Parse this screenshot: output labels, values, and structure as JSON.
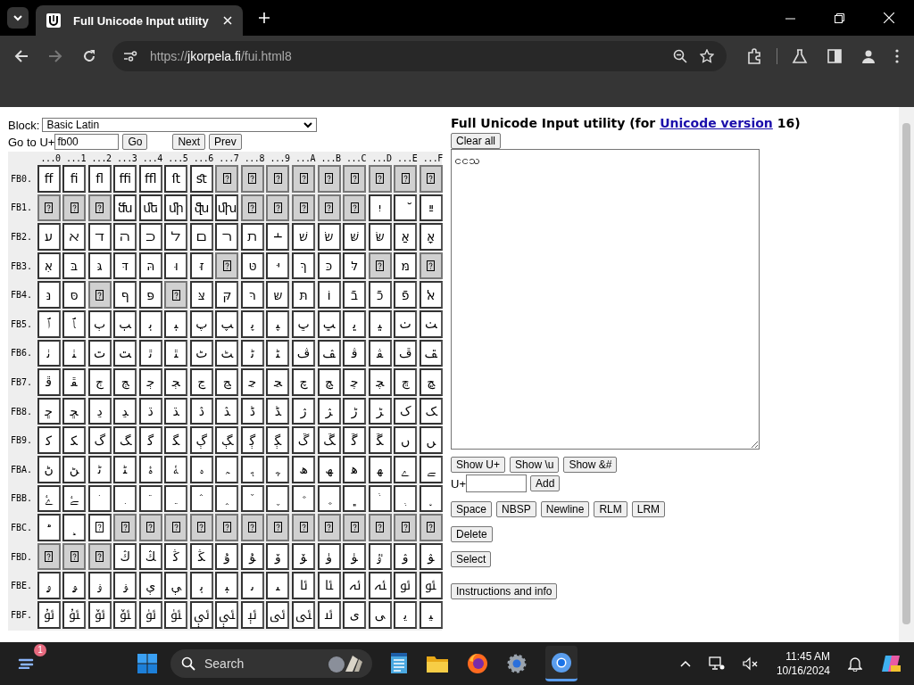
{
  "browser": {
    "tab_title": "Full Unicode Input utility",
    "url_scheme": "https://",
    "url_host": "jkorpela.fi",
    "url_path": "/fui.html8"
  },
  "controls": {
    "block_label": "Block:",
    "block_value": "Basic Latin",
    "goto_label": "Go to U+",
    "goto_value": "fb00",
    "go": "Go",
    "next": "Next",
    "prev": "Prev"
  },
  "grid": {
    "columns": [
      "...0",
      "...1",
      "...2",
      "...3",
      "...4",
      "...5",
      "...6",
      "...7",
      "...8",
      "...9",
      "...A",
      "...B",
      "...C",
      "...D",
      "...E",
      "...F"
    ],
    "rows": [
      {
        "label": "FB0.",
        "cells": [
          {
            "kind": "char",
            "text": "ﬀ"
          },
          {
            "kind": "char",
            "text": "ﬁ"
          },
          {
            "kind": "char",
            "text": "ﬂ"
          },
          {
            "kind": "char",
            "text": "ﬃ"
          },
          {
            "kind": "char",
            "text": "ﬄ"
          },
          {
            "kind": "char",
            "text": "ﬅ"
          },
          {
            "kind": "char",
            "text": "ﬆ"
          },
          {
            "kind": "unassigned"
          },
          {
            "kind": "unassigned"
          },
          {
            "kind": "unassigned"
          },
          {
            "kind": "unassigned"
          },
          {
            "kind": "unassigned"
          },
          {
            "kind": "unassigned"
          },
          {
            "kind": "unassigned"
          },
          {
            "kind": "unassigned"
          },
          {
            "kind": "unassigned"
          }
        ]
      },
      {
        "label": "FB1.",
        "cells": [
          {
            "kind": "unassigned"
          },
          {
            "kind": "unassigned"
          },
          {
            "kind": "unassigned"
          },
          {
            "kind": "char",
            "text": "ﬓ"
          },
          {
            "kind": "char",
            "text": "ﬔ"
          },
          {
            "kind": "char",
            "text": "ﬕ"
          },
          {
            "kind": "char",
            "text": "ﬖ"
          },
          {
            "kind": "char",
            "text": "ﬗ"
          },
          {
            "kind": "unassigned"
          },
          {
            "kind": "unassigned"
          },
          {
            "kind": "unassigned"
          },
          {
            "kind": "unassigned"
          },
          {
            "kind": "unassigned"
          },
          {
            "kind": "char",
            "text": "יִ"
          },
          {
            "kind": "char",
            "text": "ﬞ"
          },
          {
            "kind": "char",
            "text": "ײַ"
          }
        ]
      },
      {
        "label": "FB2.",
        "cells": [
          {
            "kind": "char",
            "text": "ﬠ"
          },
          {
            "kind": "char",
            "text": "ﬡ"
          },
          {
            "kind": "char",
            "text": "ﬢ"
          },
          {
            "kind": "char",
            "text": "ﬣ"
          },
          {
            "kind": "char",
            "text": "ﬤ"
          },
          {
            "kind": "char",
            "text": "ﬥ"
          },
          {
            "kind": "char",
            "text": "ﬦ"
          },
          {
            "kind": "char",
            "text": "ﬧ"
          },
          {
            "kind": "char",
            "text": "ﬨ"
          },
          {
            "kind": "char",
            "text": "﬩"
          },
          {
            "kind": "char",
            "text": "שׁ"
          },
          {
            "kind": "char",
            "text": "שׂ"
          },
          {
            "kind": "char",
            "text": "שּׁ"
          },
          {
            "kind": "char",
            "text": "שּׂ"
          },
          {
            "kind": "char",
            "text": "אַ"
          },
          {
            "kind": "char",
            "text": "אָ"
          }
        ]
      },
      {
        "label": "FB3.",
        "cells": [
          {
            "kind": "char",
            "text": "אּ"
          },
          {
            "kind": "char",
            "text": "בּ"
          },
          {
            "kind": "char",
            "text": "גּ"
          },
          {
            "kind": "char",
            "text": "דּ"
          },
          {
            "kind": "char",
            "text": "הּ"
          },
          {
            "kind": "char",
            "text": "וּ"
          },
          {
            "kind": "char",
            "text": "זּ"
          },
          {
            "kind": "unassigned"
          },
          {
            "kind": "char",
            "text": "טּ"
          },
          {
            "kind": "char",
            "text": "יּ"
          },
          {
            "kind": "char",
            "text": "ךּ"
          },
          {
            "kind": "char",
            "text": "כּ"
          },
          {
            "kind": "char",
            "text": "לּ"
          },
          {
            "kind": "unassigned"
          },
          {
            "kind": "char",
            "text": "מּ"
          },
          {
            "kind": "unassigned"
          }
        ]
      },
      {
        "label": "FB4.",
        "cells": [
          {
            "kind": "char",
            "text": "נּ"
          },
          {
            "kind": "char",
            "text": "סּ"
          },
          {
            "kind": "unassigned"
          },
          {
            "kind": "char",
            "text": "ףּ"
          },
          {
            "kind": "char",
            "text": "פּ"
          },
          {
            "kind": "unassigned"
          },
          {
            "kind": "char",
            "text": "צּ"
          },
          {
            "kind": "char",
            "text": "קּ"
          },
          {
            "kind": "char",
            "text": "רּ"
          },
          {
            "kind": "char",
            "text": "שּ"
          },
          {
            "kind": "char",
            "text": "תּ"
          },
          {
            "kind": "char",
            "text": "וֹ"
          },
          {
            "kind": "char",
            "text": "בֿ"
          },
          {
            "kind": "char",
            "text": "כֿ"
          },
          {
            "kind": "char",
            "text": "פֿ"
          },
          {
            "kind": "char",
            "text": "ﭏ"
          }
        ]
      },
      {
        "label": "FB5.",
        "cells": [
          {
            "kind": "char",
            "text": "ﭐ"
          },
          {
            "kind": "char",
            "text": "ﭑ"
          },
          {
            "kind": "char",
            "text": "ﭒ"
          },
          {
            "kind": "char",
            "text": "ﭓ"
          },
          {
            "kind": "char",
            "text": "ﭔ"
          },
          {
            "kind": "char",
            "text": "ﭕ"
          },
          {
            "kind": "char",
            "text": "ﭖ"
          },
          {
            "kind": "char",
            "text": "ﭗ"
          },
          {
            "kind": "char",
            "text": "ﭘ"
          },
          {
            "kind": "char",
            "text": "ﭙ"
          },
          {
            "kind": "char",
            "text": "ﭚ"
          },
          {
            "kind": "char",
            "text": "ﭛ"
          },
          {
            "kind": "char",
            "text": "ﭜ"
          },
          {
            "kind": "char",
            "text": "ﭝ"
          },
          {
            "kind": "char",
            "text": "ﭞ"
          },
          {
            "kind": "char",
            "text": "ﭟ"
          }
        ]
      },
      {
        "label": "FB6.",
        "cells": [
          {
            "kind": "char",
            "text": "ﭠ"
          },
          {
            "kind": "char",
            "text": "ﭡ"
          },
          {
            "kind": "char",
            "text": "ﭢ"
          },
          {
            "kind": "char",
            "text": "ﭣ"
          },
          {
            "kind": "char",
            "text": "ﭤ"
          },
          {
            "kind": "char",
            "text": "ﭥ"
          },
          {
            "kind": "char",
            "text": "ﭦ"
          },
          {
            "kind": "char",
            "text": "ﭧ"
          },
          {
            "kind": "char",
            "text": "ﭨ"
          },
          {
            "kind": "char",
            "text": "ﭩ"
          },
          {
            "kind": "char",
            "text": "ﭪ"
          },
          {
            "kind": "char",
            "text": "ﭫ"
          },
          {
            "kind": "char",
            "text": "ﭬ"
          },
          {
            "kind": "char",
            "text": "ﭭ"
          },
          {
            "kind": "char",
            "text": "ﭮ"
          },
          {
            "kind": "char",
            "text": "ﭯ"
          }
        ]
      },
      {
        "label": "FB7.",
        "cells": [
          {
            "kind": "char",
            "text": "ﭰ"
          },
          {
            "kind": "char",
            "text": "ﭱ"
          },
          {
            "kind": "char",
            "text": "ﭲ"
          },
          {
            "kind": "char",
            "text": "ﭳ"
          },
          {
            "kind": "char",
            "text": "ﭴ"
          },
          {
            "kind": "char",
            "text": "ﭵ"
          },
          {
            "kind": "char",
            "text": "ﭶ"
          },
          {
            "kind": "char",
            "text": "ﭷ"
          },
          {
            "kind": "char",
            "text": "ﭸ"
          },
          {
            "kind": "char",
            "text": "ﭹ"
          },
          {
            "kind": "char",
            "text": "ﭺ"
          },
          {
            "kind": "char",
            "text": "ﭻ"
          },
          {
            "kind": "char",
            "text": "ﭼ"
          },
          {
            "kind": "char",
            "text": "ﭽ"
          },
          {
            "kind": "char",
            "text": "ﭾ"
          },
          {
            "kind": "char",
            "text": "ﭿ"
          }
        ]
      },
      {
        "label": "FB8.",
        "cells": [
          {
            "kind": "char",
            "text": "ﮀ"
          },
          {
            "kind": "char",
            "text": "ﮁ"
          },
          {
            "kind": "char",
            "text": "ﮂ"
          },
          {
            "kind": "char",
            "text": "ﮃ"
          },
          {
            "kind": "char",
            "text": "ﮄ"
          },
          {
            "kind": "char",
            "text": "ﮅ"
          },
          {
            "kind": "char",
            "text": "ﮆ"
          },
          {
            "kind": "char",
            "text": "ﮇ"
          },
          {
            "kind": "char",
            "text": "ﮈ"
          },
          {
            "kind": "char",
            "text": "ﮉ"
          },
          {
            "kind": "char",
            "text": "ﮊ"
          },
          {
            "kind": "char",
            "text": "ﮋ"
          },
          {
            "kind": "char",
            "text": "ﮌ"
          },
          {
            "kind": "char",
            "text": "ﮍ"
          },
          {
            "kind": "char",
            "text": "ﮎ"
          },
          {
            "kind": "char",
            "text": "ﮏ"
          }
        ]
      },
      {
        "label": "FB9.",
        "cells": [
          {
            "kind": "char",
            "text": "ﮐ"
          },
          {
            "kind": "char",
            "text": "ﮑ"
          },
          {
            "kind": "char",
            "text": "ﮒ"
          },
          {
            "kind": "char",
            "text": "ﮓ"
          },
          {
            "kind": "char",
            "text": "ﮔ"
          },
          {
            "kind": "char",
            "text": "ﮕ"
          },
          {
            "kind": "char",
            "text": "ﮖ"
          },
          {
            "kind": "char",
            "text": "ﮗ"
          },
          {
            "kind": "char",
            "text": "ﮘ"
          },
          {
            "kind": "char",
            "text": "ﮙ"
          },
          {
            "kind": "char",
            "text": "ﮚ"
          },
          {
            "kind": "char",
            "text": "ﮛ"
          },
          {
            "kind": "char",
            "text": "ﮜ"
          },
          {
            "kind": "char",
            "text": "ﮝ"
          },
          {
            "kind": "char",
            "text": "ﮞ"
          },
          {
            "kind": "char",
            "text": "ﮟ"
          }
        ]
      },
      {
        "label": "FBA.",
        "cells": [
          {
            "kind": "char",
            "text": "ﮠ"
          },
          {
            "kind": "char",
            "text": "ﮡ"
          },
          {
            "kind": "char",
            "text": "ﮢ"
          },
          {
            "kind": "char",
            "text": "ﮣ"
          },
          {
            "kind": "char",
            "text": "ﮤ"
          },
          {
            "kind": "char",
            "text": "ﮥ"
          },
          {
            "kind": "char",
            "text": "ﮦ"
          },
          {
            "kind": "char",
            "text": "ﮧ"
          },
          {
            "kind": "char",
            "text": "ﮨ"
          },
          {
            "kind": "char",
            "text": "ﮩ"
          },
          {
            "kind": "char",
            "text": "ﮪ"
          },
          {
            "kind": "char",
            "text": "ﮫ"
          },
          {
            "kind": "char",
            "text": "ﮬ"
          },
          {
            "kind": "char",
            "text": "ﮭ"
          },
          {
            "kind": "char",
            "text": "ﮮ"
          },
          {
            "kind": "char",
            "text": "ﮯ"
          }
        ]
      },
      {
        "label": "FBB.",
        "cells": [
          {
            "kind": "char",
            "text": "ﮰ"
          },
          {
            "kind": "char",
            "text": "ﮱ"
          },
          {
            "kind": "char",
            "text": "﮲"
          },
          {
            "kind": "char",
            "text": "﮳"
          },
          {
            "kind": "char",
            "text": "﮴"
          },
          {
            "kind": "char",
            "text": "﮵"
          },
          {
            "kind": "char",
            "text": "﮶"
          },
          {
            "kind": "char",
            "text": "﮷"
          },
          {
            "kind": "char",
            "text": "﮸"
          },
          {
            "kind": "char",
            "text": "﮹"
          },
          {
            "kind": "char",
            "text": "﮺"
          },
          {
            "kind": "char",
            "text": "﮻"
          },
          {
            "kind": "char",
            "text": "﮼"
          },
          {
            "kind": "char",
            "text": "﮽"
          },
          {
            "kind": "char",
            "text": "﮾"
          },
          {
            "kind": "char",
            "text": "﮿"
          }
        ]
      },
      {
        "label": "FBC.",
        "cells": [
          {
            "kind": "char",
            "text": "﯀"
          },
          {
            "kind": "char",
            "text": "﯁"
          },
          {
            "kind": "nofont"
          },
          {
            "kind": "unassigned"
          },
          {
            "kind": "unassigned"
          },
          {
            "kind": "unassigned"
          },
          {
            "kind": "unassigned"
          },
          {
            "kind": "unassigned"
          },
          {
            "kind": "unassigned"
          },
          {
            "kind": "unassigned"
          },
          {
            "kind": "unassigned"
          },
          {
            "kind": "unassigned"
          },
          {
            "kind": "unassigned"
          },
          {
            "kind": "unassigned"
          },
          {
            "kind": "unassigned"
          },
          {
            "kind": "unassigned"
          }
        ]
      },
      {
        "label": "FBD.",
        "cells": [
          {
            "kind": "unassigned"
          },
          {
            "kind": "unassigned"
          },
          {
            "kind": "unassigned"
          },
          {
            "kind": "char",
            "text": "ﯓ"
          },
          {
            "kind": "char",
            "text": "ﯔ"
          },
          {
            "kind": "char",
            "text": "ﯕ"
          },
          {
            "kind": "char",
            "text": "ﯖ"
          },
          {
            "kind": "char",
            "text": "ﯗ"
          },
          {
            "kind": "char",
            "text": "ﯘ"
          },
          {
            "kind": "char",
            "text": "ﯙ"
          },
          {
            "kind": "char",
            "text": "ﯚ"
          },
          {
            "kind": "char",
            "text": "ﯛ"
          },
          {
            "kind": "char",
            "text": "ﯜ"
          },
          {
            "kind": "char",
            "text": "ﯝ"
          },
          {
            "kind": "char",
            "text": "ﯞ"
          },
          {
            "kind": "char",
            "text": "ﯟ"
          }
        ]
      },
      {
        "label": "FBE.",
        "cells": [
          {
            "kind": "char",
            "text": "ﯠ"
          },
          {
            "kind": "char",
            "text": "ﯡ"
          },
          {
            "kind": "char",
            "text": "ﯢ"
          },
          {
            "kind": "char",
            "text": "ﯣ"
          },
          {
            "kind": "char",
            "text": "ﯤ"
          },
          {
            "kind": "char",
            "text": "ﯥ"
          },
          {
            "kind": "char",
            "text": "ﯦ"
          },
          {
            "kind": "char",
            "text": "ﯧ"
          },
          {
            "kind": "char",
            "text": "ﯨ"
          },
          {
            "kind": "char",
            "text": "ﯩ"
          },
          {
            "kind": "char",
            "text": "ﯪ"
          },
          {
            "kind": "char",
            "text": "ﯫ"
          },
          {
            "kind": "char",
            "text": "ﯬ"
          },
          {
            "kind": "char",
            "text": "ﯭ"
          },
          {
            "kind": "char",
            "text": "ﯮ"
          },
          {
            "kind": "char",
            "text": "ﯯ"
          }
        ]
      },
      {
        "label": "FBF.",
        "cells": [
          {
            "kind": "char",
            "text": "ﯰ"
          },
          {
            "kind": "char",
            "text": "ﯱ"
          },
          {
            "kind": "char",
            "text": "ﯲ"
          },
          {
            "kind": "char",
            "text": "ﯳ"
          },
          {
            "kind": "char",
            "text": "ﯴ"
          },
          {
            "kind": "char",
            "text": "ﯵ"
          },
          {
            "kind": "char",
            "text": "ﯶ"
          },
          {
            "kind": "char",
            "text": "ﯷ"
          },
          {
            "kind": "char",
            "text": "ﯸ"
          },
          {
            "kind": "char",
            "text": "ﯹ"
          },
          {
            "kind": "char",
            "text": "ﯺ"
          },
          {
            "kind": "char",
            "text": "ﯻ"
          },
          {
            "kind": "char",
            "text": "ﯼ"
          },
          {
            "kind": "char",
            "text": "ﯽ"
          },
          {
            "kind": "char",
            "text": "ﯾ"
          },
          {
            "kind": "char",
            "text": "ﯿ"
          }
        ]
      }
    ]
  },
  "editor": {
    "title_start": "Full Unicode Input utility (for ",
    "title_link": "Unicode version",
    "title_end": " 16)",
    "clear": "Clear all",
    "text": "ငငသ",
    "show_buttons": [
      "Show U+",
      "Show \\u",
      "Show &#"
    ],
    "add_label": "U+",
    "add": "Add",
    "insert_buttons": [
      "Space",
      "NBSP",
      "Newline",
      "RLM",
      "LRM"
    ],
    "delete": "Delete",
    "select": "Select",
    "info": "Instructions and info"
  },
  "taskbar": {
    "badge": "1",
    "search": "Search",
    "time": "11:45 AM",
    "date": "10/16/2024"
  }
}
